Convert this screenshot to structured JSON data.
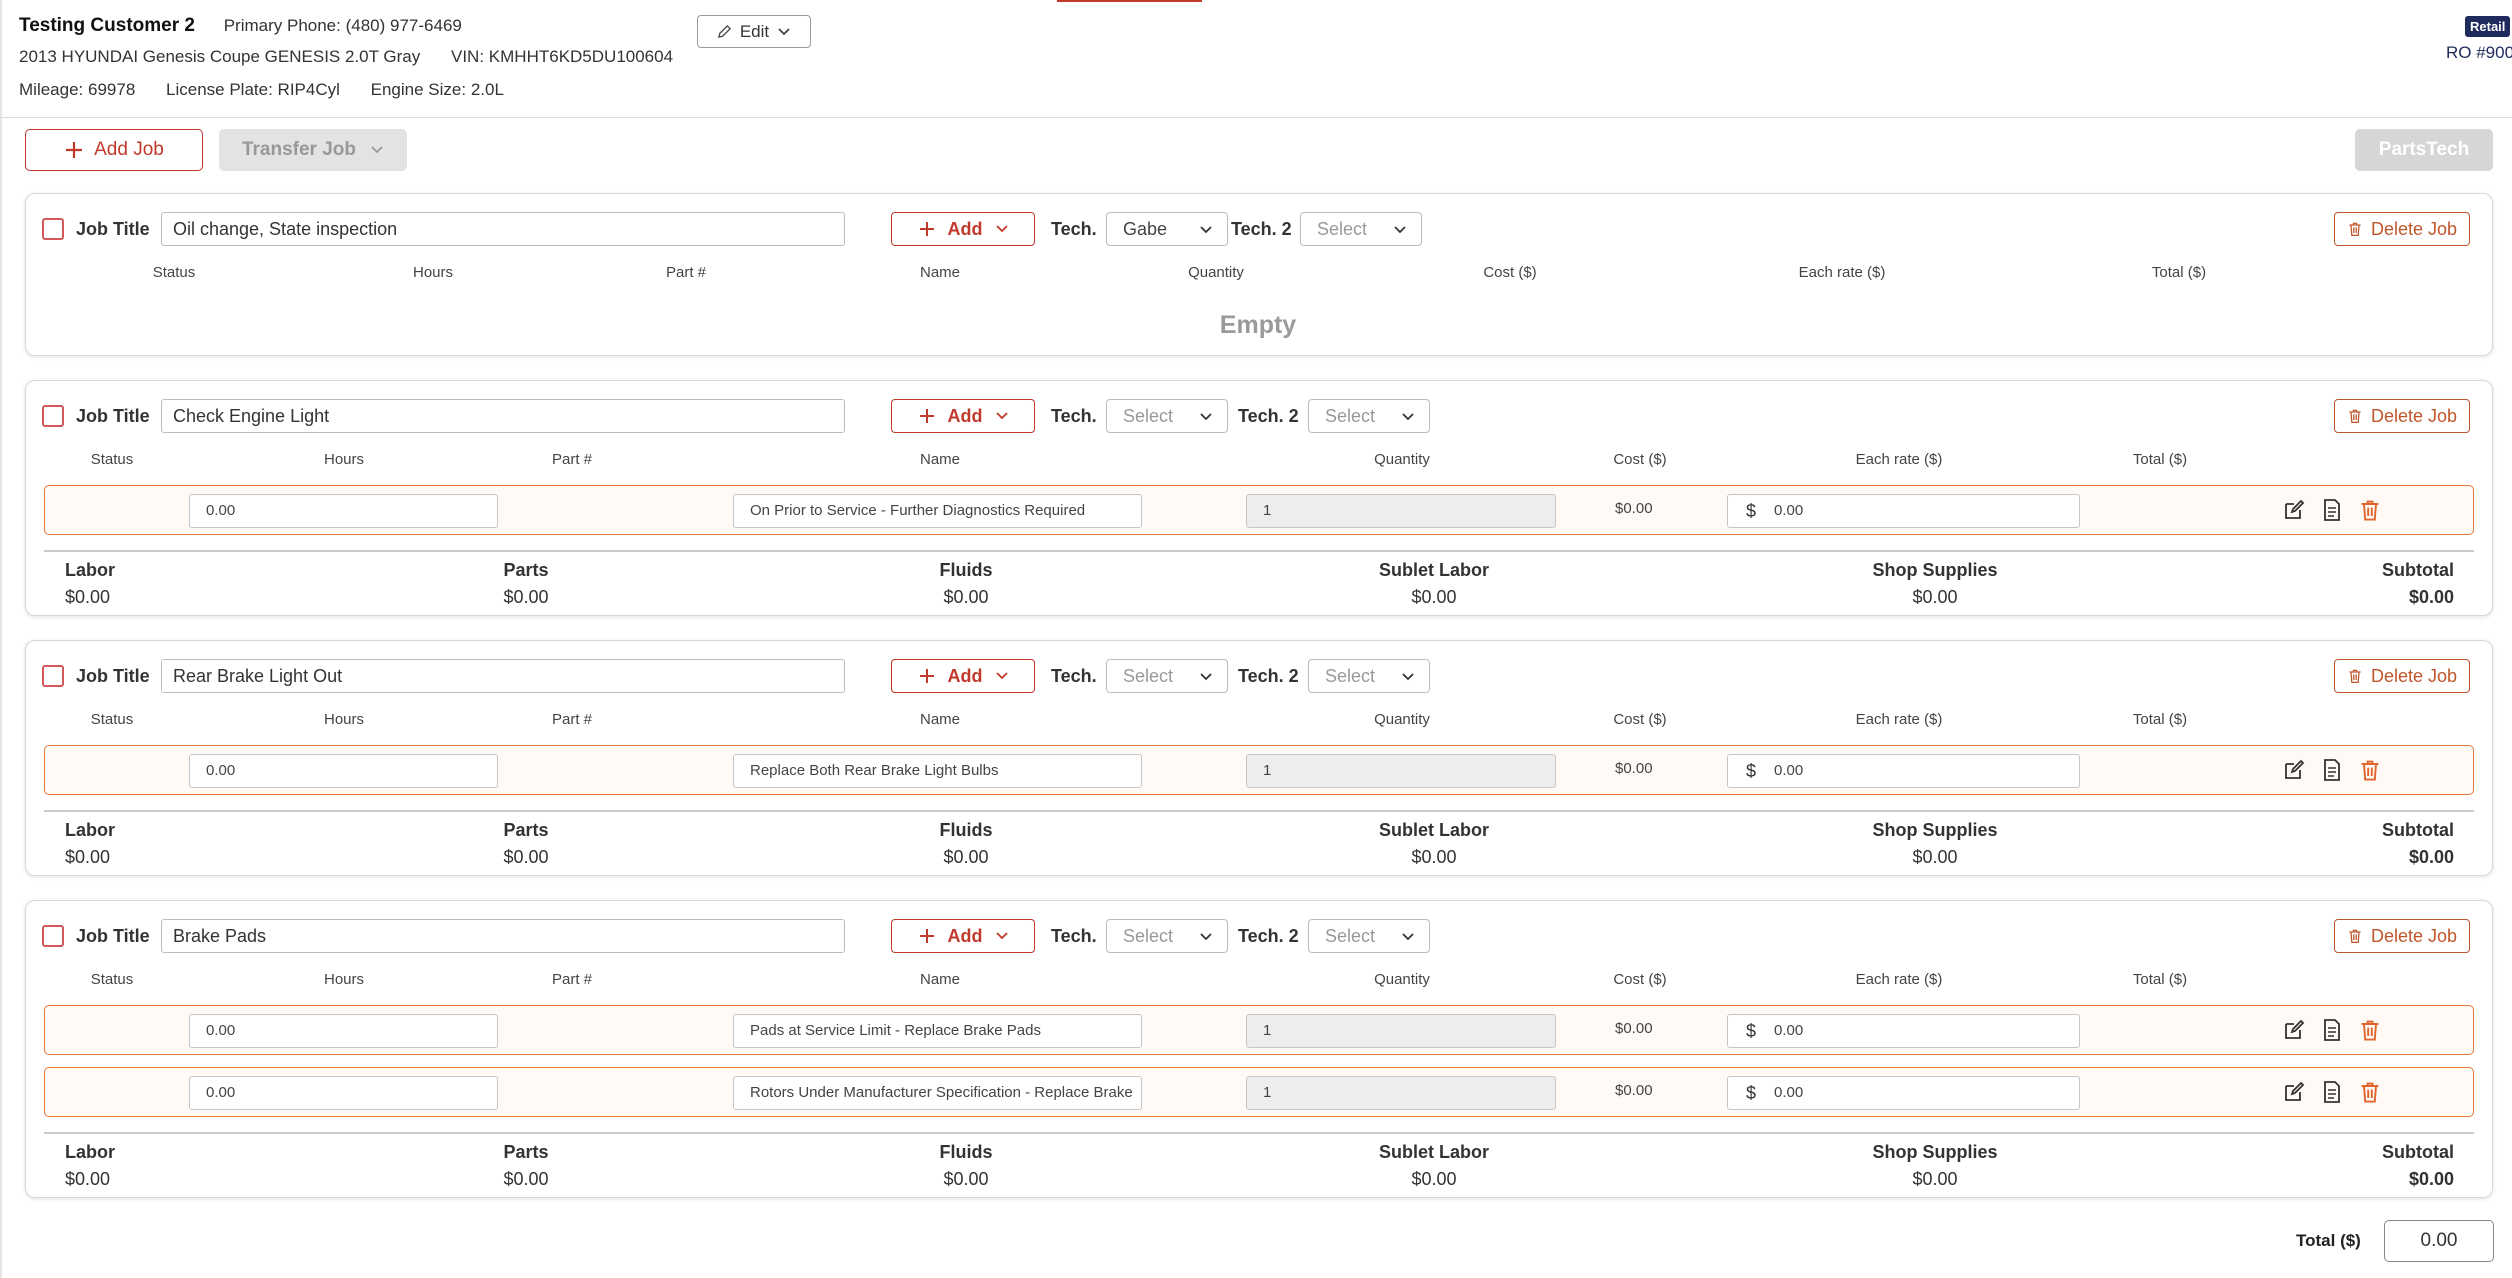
{
  "header": {
    "customer_name": "Testing Customer 2",
    "primary_phone_label": "Primary Phone:",
    "primary_phone": "(480) 977-6469",
    "vehicle": "2013 HYUNDAI Genesis Coupe GENESIS 2.0T Gray",
    "vin_label": "VIN:",
    "vin": "KMHHT6KD5DU100604",
    "mileage_label": "Mileage:",
    "mileage": "69978",
    "plate_label": "License Plate:",
    "plate": "RIP4Cyl",
    "engine_label": "Engine Size:",
    "engine": "2.0L",
    "edit_label": "Edit",
    "badge": "Retail",
    "ro_number": "RO #900"
  },
  "toolbar": {
    "add_job": "Add Job",
    "transfer_job": "Transfer Job",
    "partstech": "PartsTech"
  },
  "labels": {
    "job_title": "Job Title",
    "add": "Add",
    "tech": "Tech.",
    "tech2": "Tech. 2",
    "delete_job": "Delete Job",
    "empty": "Empty",
    "dollar": "$",
    "col_status": "Status",
    "col_hours": "Hours",
    "col_part": "Part #",
    "col_name": "Name",
    "col_quantity": "Quantity",
    "col_cost": "Cost ($)",
    "col_each_rate": "Each rate ($)",
    "col_total": "Total ($)",
    "sum_labor": "Labor",
    "sum_parts": "Parts",
    "sum_fluids": "Fluids",
    "sum_sublet": "Sublet Labor",
    "sum_shop": "Shop Supplies",
    "sum_subtotal": "Subtotal"
  },
  "jobs": [
    {
      "title": "Oil change,  State inspection",
      "tech": "Gabe",
      "tech2": "Select",
      "lines": []
    },
    {
      "title": "Check Engine Light",
      "tech": "Select",
      "tech2": "Select",
      "lines": [
        {
          "hours": "0.00",
          "name": "On Prior to Service - Further Diagnostics Required",
          "quantity": "1",
          "each_rate": "0.00",
          "total": "$0.00"
        }
      ],
      "summary": {
        "labor": "$0.00",
        "parts": "$0.00",
        "fluids": "$0.00",
        "sublet": "$0.00",
        "shop": "$0.00",
        "subtotal": "$0.00"
      }
    },
    {
      "title": "Rear Brake Light Out",
      "tech": "Select",
      "tech2": "Select",
      "lines": [
        {
          "hours": "0.00",
          "name": "Replace Both Rear Brake Light Bulbs",
          "quantity": "1",
          "each_rate": "0.00",
          "total": "$0.00"
        }
      ],
      "summary": {
        "labor": "$0.00",
        "parts": "$0.00",
        "fluids": "$0.00",
        "sublet": "$0.00",
        "shop": "$0.00",
        "subtotal": "$0.00"
      }
    },
    {
      "title": "Brake Pads",
      "tech": "Select",
      "tech2": "Select",
      "lines": [
        {
          "hours": "0.00",
          "name": "Pads at Service Limit - Replace Brake Pads",
          "quantity": "1",
          "each_rate": "0.00",
          "total": "$0.00"
        },
        {
          "hours": "0.00",
          "name": "Rotors Under Manufacturer Specification - Replace Brake",
          "quantity": "1",
          "each_rate": "0.00",
          "total": "$0.00"
        }
      ],
      "summary": {
        "labor": "$0.00",
        "parts": "$0.00",
        "fluids": "$0.00",
        "sublet": "$0.00",
        "shop": "$0.00",
        "subtotal": "$0.00"
      }
    }
  ],
  "footer": {
    "total_label": "Total ($)",
    "total_value": "0.00"
  },
  "colors": {
    "accent_red": "#c0392b",
    "delete_orange": "#c0562b",
    "row_border": "#e07a3a",
    "badge_navy": "#1f2b5c"
  },
  "icons": [
    "pencil-icon",
    "chevron-down-icon",
    "plus-icon",
    "trash-icon",
    "edit-icon",
    "document-icon"
  ]
}
